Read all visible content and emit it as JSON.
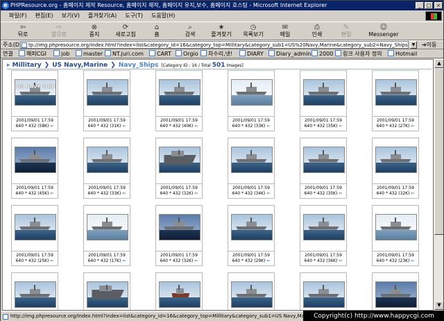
{
  "window": {
    "title": "PHPResource.org - 홈페이지 제작 Resource, 홈페이지 제작, 홈페이지 유지,보수, 홈페이지 호스팅 - Microsoft Internet Explorer",
    "minimize": "_",
    "maximize": "□",
    "close": "×"
  },
  "menu": [
    "파일(F)",
    "편집(E)",
    "보기(V)",
    "즐겨찾기(A)",
    "도구(T)",
    "도움말(H)"
  ],
  "toolbar": {
    "back": "뒤로",
    "forward": "앞으로",
    "stop": "중지",
    "refresh": "새로고침",
    "home": "홈",
    "search": "검색",
    "favorites": "즐겨찾기",
    "history": "목록보기",
    "mail": "메일",
    "print": "인쇄",
    "edit": "편집",
    "messenger": "Messenger"
  },
  "address": {
    "label": "주소(D)",
    "url": "tp://img.phpresource.org/index.html?index=list&category_id=16&category_top=Millitary&category_sub1=US%20Navy,Marine&category_sub2=Navy_Ships",
    "go": "이동"
  },
  "links": {
    "label": "연결",
    "items": [
      "해피CGI",
      "job",
      "master",
      "NT.juri.com",
      "CART",
      "Orgio",
      "차수리,넷!",
      "DIARY",
      "Diary_admin",
      "2000",
      "링크 사용자 정의",
      "Hotmail"
    ]
  },
  "breadcrumb": {
    "c1": "Millitary",
    "c2": "US Navy,Marine",
    "c3": "Navy_Ships",
    "count_prefix": "[Category ID : 16 / Total",
    "total": "501",
    "count_suffix": "Images]"
  },
  "thumbnails": [
    {
      "date": "2001/09/01 17:59",
      "size": "640 * 432 (58K)",
      "badge": "US NAVY SHIPS"
    },
    {
      "date": "2001/09/01 17:59",
      "size": "640 * 432 (31K)"
    },
    {
      "date": "2001/09/01 17:59",
      "size": "640 * 432 (40K)"
    },
    {
      "date": "2001/09/01 17:59",
      "size": "640 * 432 (33K)"
    },
    {
      "date": "2001/09/01 17:59",
      "size": "640 * 432 (35K)"
    },
    {
      "date": "2001/09/01 17:59",
      "size": "640 * 432 (27K)"
    },
    {
      "date": "2001/09/01 17:59",
      "size": "640 * 432 (45K)"
    },
    {
      "date": "2001/09/01 17:59",
      "size": "640 * 432 (33K)"
    },
    {
      "date": "2001/09/01 17:59",
      "size": "640 * 432 (32K)"
    },
    {
      "date": "2001/09/01 17:59",
      "size": "640 * 432 (34K)"
    },
    {
      "date": "2001/09/01 17:59",
      "size": "640 * 432 (35K)"
    },
    {
      "date": "2001/09/01 17:59",
      "size": "640 * 432 (32K)"
    },
    {
      "date": "2001/09/01 17:59",
      "size": "640 * 432 (25K)"
    },
    {
      "date": "2001/09/01 17:59",
      "size": "640 * 432 (17K)"
    },
    {
      "date": "2001/09/01 17:59",
      "size": "640 * 432 (32K)"
    },
    {
      "date": "2001/09/01 17:59",
      "size": "640 * 432 (29K)"
    },
    {
      "date": "2001/09/01 17:59",
      "size": "640 * 432 (36K)"
    },
    {
      "date": "2001/09/01 17:59",
      "size": "640 * 432 (23K)"
    },
    {
      "date": "",
      "size": ""
    },
    {
      "date": "",
      "size": ""
    },
    {
      "date": "",
      "size": ""
    },
    {
      "date": "",
      "size": ""
    },
    {
      "date": "",
      "size": ""
    },
    {
      "date": "",
      "size": ""
    }
  ],
  "status": {
    "text": "http://img.phpresource.org/index.html?index=list&category_id=16&category_top=Millitary&category_sub1=US Navy,Marine",
    "copyright": "Copyright(c) http://www.happycgi.com"
  }
}
